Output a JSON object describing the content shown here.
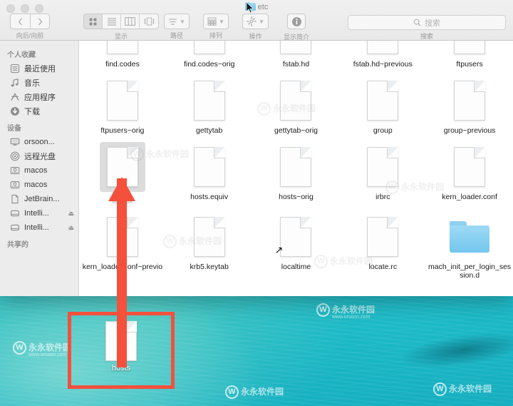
{
  "window": {
    "title": "etc",
    "title_icon": "folder-icon",
    "traffic_lights": [
      "close-button",
      "minimize-button",
      "maximize-button"
    ]
  },
  "toolbar": {
    "nav": {
      "back_icon": "chevron-left-icon",
      "forward_icon": "chevron-right-icon",
      "caption": "向后/向前"
    },
    "view": {
      "caption": "显示",
      "modes": [
        {
          "icon": "grid-view-icon",
          "active": true
        },
        {
          "icon": "list-view-icon",
          "active": false
        },
        {
          "icon": "column-view-icon",
          "active": false
        },
        {
          "icon": "coverflow-view-icon",
          "active": false
        }
      ]
    },
    "path": {
      "caption": "路径",
      "icon": "path-icon",
      "chevron": "chevron-down-icon"
    },
    "arrange": {
      "caption": "排列",
      "icon": "arrange-icon",
      "chevron": "chevron-down-icon"
    },
    "action": {
      "caption": "操作",
      "icon": "gear-icon",
      "chevron": "chevron-down-icon"
    },
    "info": {
      "caption": "显示简介",
      "icon": "info-icon"
    },
    "search": {
      "placeholder": "搜索",
      "value": "",
      "caption": "搜索",
      "icon": "search-icon"
    }
  },
  "sidebar": {
    "sections": [
      {
        "header": "个人收藏",
        "items": [
          {
            "label": "最近使用",
            "icon": "recents-icon",
            "eject": false
          },
          {
            "label": "音乐",
            "icon": "music-note-icon",
            "eject": false
          },
          {
            "label": "应用程序",
            "icon": "applications-icon",
            "eject": false
          },
          {
            "label": "下载",
            "icon": "downloads-icon",
            "eject": false
          }
        ]
      },
      {
        "header": "设备",
        "items": [
          {
            "label": "orsoon...",
            "icon": "computer-icon",
            "eject": false
          },
          {
            "label": "远程光盘",
            "icon": "remote-disc-icon",
            "eject": false
          },
          {
            "label": "macos",
            "icon": "hard-disk-icon",
            "eject": false
          },
          {
            "label": "macos",
            "icon": "hard-disk-icon",
            "eject": false
          },
          {
            "label": "JetBrain...",
            "icon": "document-icon",
            "eject": false
          },
          {
            "label": "Intelli...",
            "icon": "external-disk-icon",
            "eject": true
          },
          {
            "label": "Intelli...",
            "icon": "external-disk-icon",
            "eject": true
          }
        ]
      },
      {
        "header": "共享的",
        "items": []
      }
    ]
  },
  "files": [
    {
      "name": "find.codes",
      "icon": "document-icon",
      "selected": false,
      "alias": false
    },
    {
      "name": "find.codes~orig",
      "icon": "document-icon",
      "selected": false,
      "alias": false
    },
    {
      "name": "fstab.hd",
      "icon": "document-icon",
      "selected": false,
      "alias": false
    },
    {
      "name": "fstab.hd~previous",
      "icon": "document-icon",
      "selected": false,
      "alias": false
    },
    {
      "name": "ftpusers",
      "icon": "document-icon",
      "selected": false,
      "alias": false
    },
    {
      "name": "ftpusers~orig",
      "icon": "document-icon",
      "selected": false,
      "alias": false
    },
    {
      "name": "gettytab",
      "icon": "document-icon",
      "selected": false,
      "alias": false
    },
    {
      "name": "gettytab~orig",
      "icon": "document-icon",
      "selected": false,
      "alias": false
    },
    {
      "name": "group",
      "icon": "document-icon",
      "selected": false,
      "alias": false
    },
    {
      "name": "group~previous",
      "icon": "document-icon",
      "selected": false,
      "alias": false
    },
    {
      "name": "hosts",
      "icon": "document-icon",
      "selected": true,
      "alias": false
    },
    {
      "name": "hosts.equiv",
      "icon": "document-icon",
      "selected": false,
      "alias": false
    },
    {
      "name": "hosts~orig",
      "icon": "document-icon",
      "selected": false,
      "alias": false
    },
    {
      "name": "irbrc",
      "icon": "document-icon",
      "selected": false,
      "alias": false
    },
    {
      "name": "kern_loader.conf",
      "icon": "document-icon",
      "selected": false,
      "alias": false
    },
    {
      "name": "kern_loader.conf~previous",
      "icon": "document-icon",
      "selected": false,
      "alias": false
    },
    {
      "name": "krb5.keytab",
      "icon": "document-icon",
      "selected": false,
      "alias": false
    },
    {
      "name": "localtime",
      "icon": "document-icon",
      "selected": false,
      "alias": true
    },
    {
      "name": "locate.rc",
      "icon": "document-icon",
      "selected": false,
      "alias": false
    },
    {
      "name": "mach_init_per_login_session.d",
      "icon": "folder-icon",
      "selected": false,
      "alias": false
    }
  ],
  "desktop": {
    "file": {
      "name": "hosts",
      "icon": "document-icon"
    },
    "annotation": {
      "box_color": "#f4503c",
      "arrow_color": "#f4503c",
      "arrow_icon": "up-arrow-annotation"
    },
    "watermarks": [
      {
        "text": "永永软件园",
        "url": "www.orsoon.com"
      }
    ]
  }
}
